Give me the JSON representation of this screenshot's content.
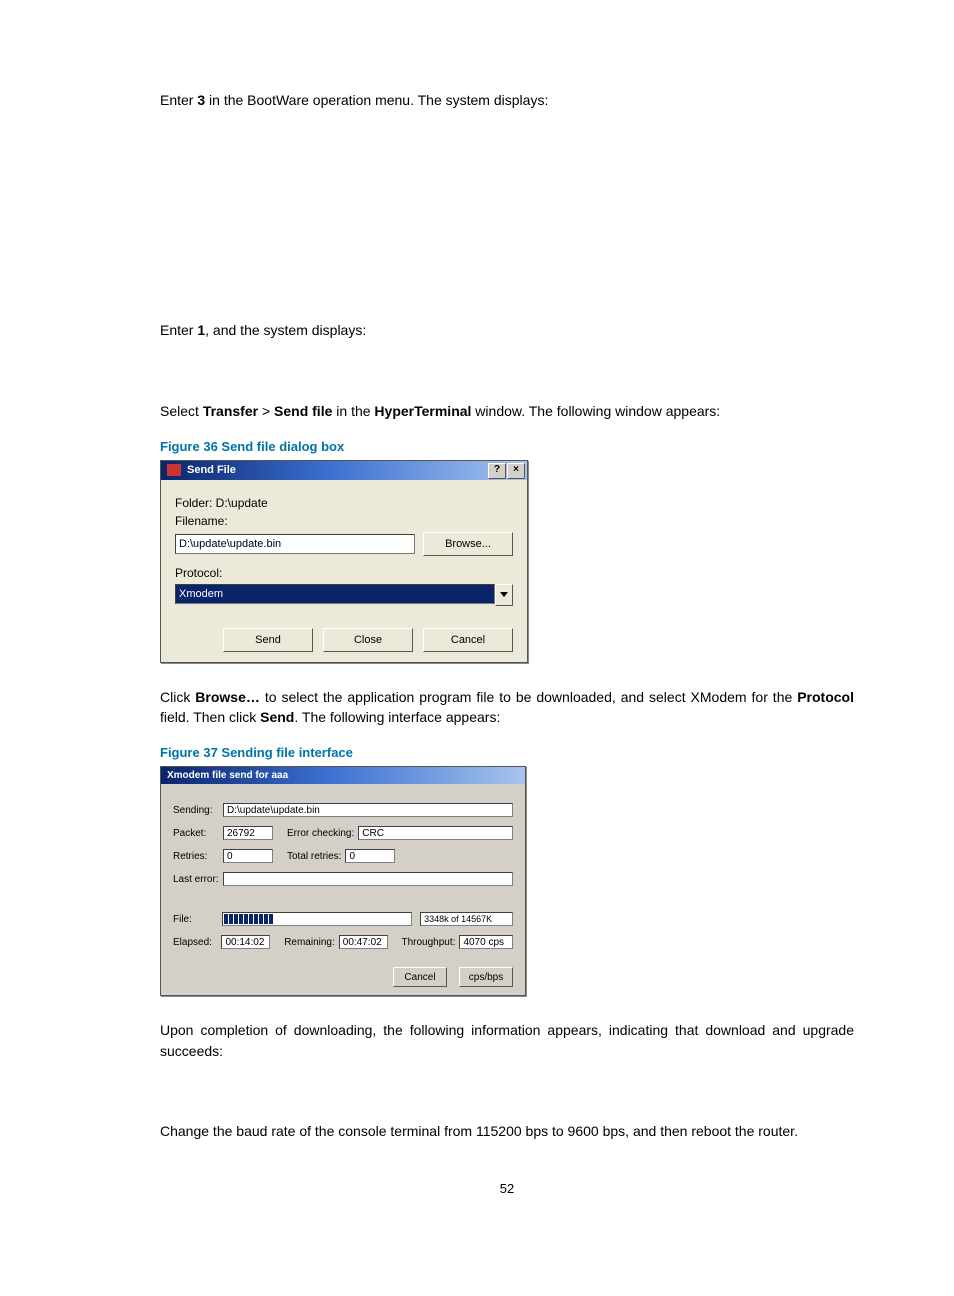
{
  "text": {
    "p1_pre": "Enter ",
    "p1_bold": "3",
    "p1_post": " in the BootWare operation menu. The system displays:",
    "p2_pre": "Enter ",
    "p2_bold": "1",
    "p2_post": ", and the system displays:",
    "p3_a": "Select ",
    "p3_b": "Transfer",
    "p3_c": " > ",
    "p3_d": "Send file",
    "p3_e": " in the ",
    "p3_f": "HyperTerminal",
    "p3_g": " window. The following window appears:",
    "fig36": "Figure 36 Send file dialog box",
    "p4_a": "Click ",
    "p4_b": "Browse…",
    "p4_c": " to select the application program file to be downloaded, and select XModem for the ",
    "p4_d": "Protocol",
    "p4_e": " field. Then click ",
    "p4_f": "Send",
    "p4_g": ". The following interface appears:",
    "fig37": "Figure 37 Sending file interface",
    "p5": "Upon completion of downloading, the following information appears, indicating that download and upgrade succeeds:",
    "p6": "Change the baud rate of the console terminal from 115200 bps to 9600 bps, and then reboot the router.",
    "pagenum": "52"
  },
  "dlg1": {
    "title": "Send File",
    "help": "?",
    "close": "×",
    "folder": "Folder:  D:\\update",
    "filename_label": "Filename:",
    "filename": "D:\\update\\update.bin",
    "browse": "Browse...",
    "protocol_label": "Protocol:",
    "protocol": "Xmodem",
    "send": "Send",
    "close_btn": "Close",
    "cancel": "Cancel"
  },
  "dlg2": {
    "title": "Xmodem file send for aaa",
    "sending_lbl": "Sending:",
    "sending": "D:\\update\\update.bin",
    "packet_lbl": "Packet:",
    "packet": "26792",
    "errchk_lbl": "Error checking:",
    "errchk": "CRC",
    "retries_lbl": "Retries:",
    "retries": "0",
    "totret_lbl": "Total retries:",
    "totret": "0",
    "lasterr_lbl": "Last error:",
    "lasterr": "",
    "file_lbl": "File:",
    "file_stat": "3348k of 14567K",
    "elapsed_lbl": "Elapsed:",
    "elapsed": "00:14:02",
    "remaining_lbl": "Remaining:",
    "remaining": "00:47:02",
    "throughput_lbl": "Throughput:",
    "throughput": "4070 cps",
    "cancel": "Cancel",
    "cpsbps": "cps/bps"
  }
}
